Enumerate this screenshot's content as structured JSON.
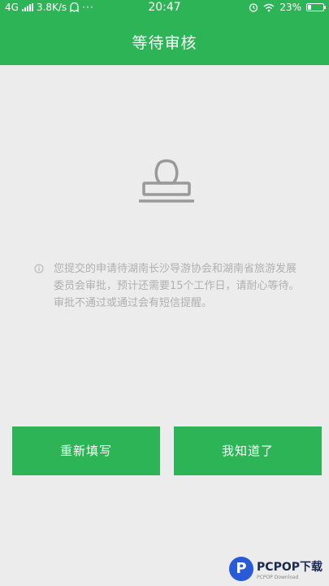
{
  "status_bar": {
    "network": "4G",
    "speed": "3.8K/s",
    "more": "···",
    "time": "20:47",
    "battery_text": "23%",
    "battery_level": 0.23,
    "icons": [
      "signal-icon",
      "ghost-icon",
      "alarm-icon",
      "wifi-icon",
      "battery-icon"
    ]
  },
  "header": {
    "title": "等待审核",
    "background": "#2db456"
  },
  "illustration": {
    "icon": "stamp-icon"
  },
  "notice": {
    "icon": "info-icon",
    "text": "您提交的申请待湖南长沙导游协会和湖南省旅游发展委员会审批，预计还需要15个工作日，请耐心等待。审批不通过或通过会有短信提醒。"
  },
  "buttons": {
    "refill": "重新填写",
    "got_it": "我知道了"
  },
  "watermark": {
    "logo": "P",
    "main": "PCPOP下载",
    "sub": "PCPOP Download"
  },
  "colors": {
    "accent": "#2db456",
    "background": "#ececec",
    "notice_text": "#b0b0b0"
  }
}
